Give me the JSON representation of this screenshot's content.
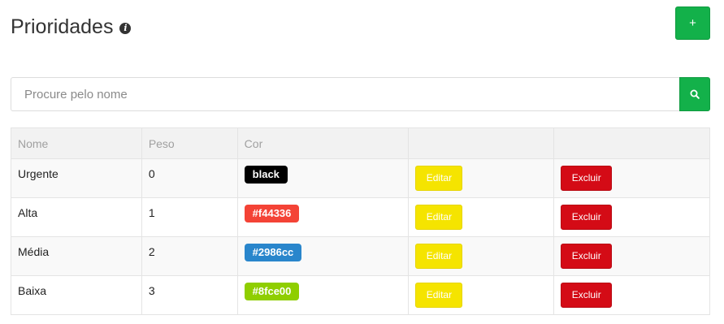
{
  "header": {
    "title": "Prioridades",
    "info_icon": "info-circle-icon",
    "add_label": "+",
    "add_color": "#13b14a"
  },
  "search": {
    "placeholder": "Procure pelo nome",
    "value": "",
    "icon": "search-icon"
  },
  "table": {
    "columns": [
      "Nome",
      "Peso",
      "Cor",
      "",
      ""
    ],
    "rows": [
      {
        "nome": "Urgente",
        "peso": "0",
        "cor": "black",
        "cor_hex": "#000000",
        "edit_label": "Editar",
        "delete_label": "Excluir"
      },
      {
        "nome": "Alta",
        "peso": "1",
        "cor": "#f44336",
        "cor_hex": "#f44336",
        "edit_label": "Editar",
        "delete_label": "Excluir"
      },
      {
        "nome": "Média",
        "peso": "2",
        "cor": "#2986cc",
        "cor_hex": "#2986cc",
        "edit_label": "Editar",
        "delete_label": "Excluir"
      },
      {
        "nome": "Baixa",
        "peso": "3",
        "cor": "#8fce00",
        "cor_hex": "#8fce00",
        "edit_label": "Editar",
        "delete_label": "Excluir"
      }
    ]
  },
  "colors": {
    "success": "#13b14a",
    "warning": "#f5e400",
    "danger": "#d40b16"
  }
}
